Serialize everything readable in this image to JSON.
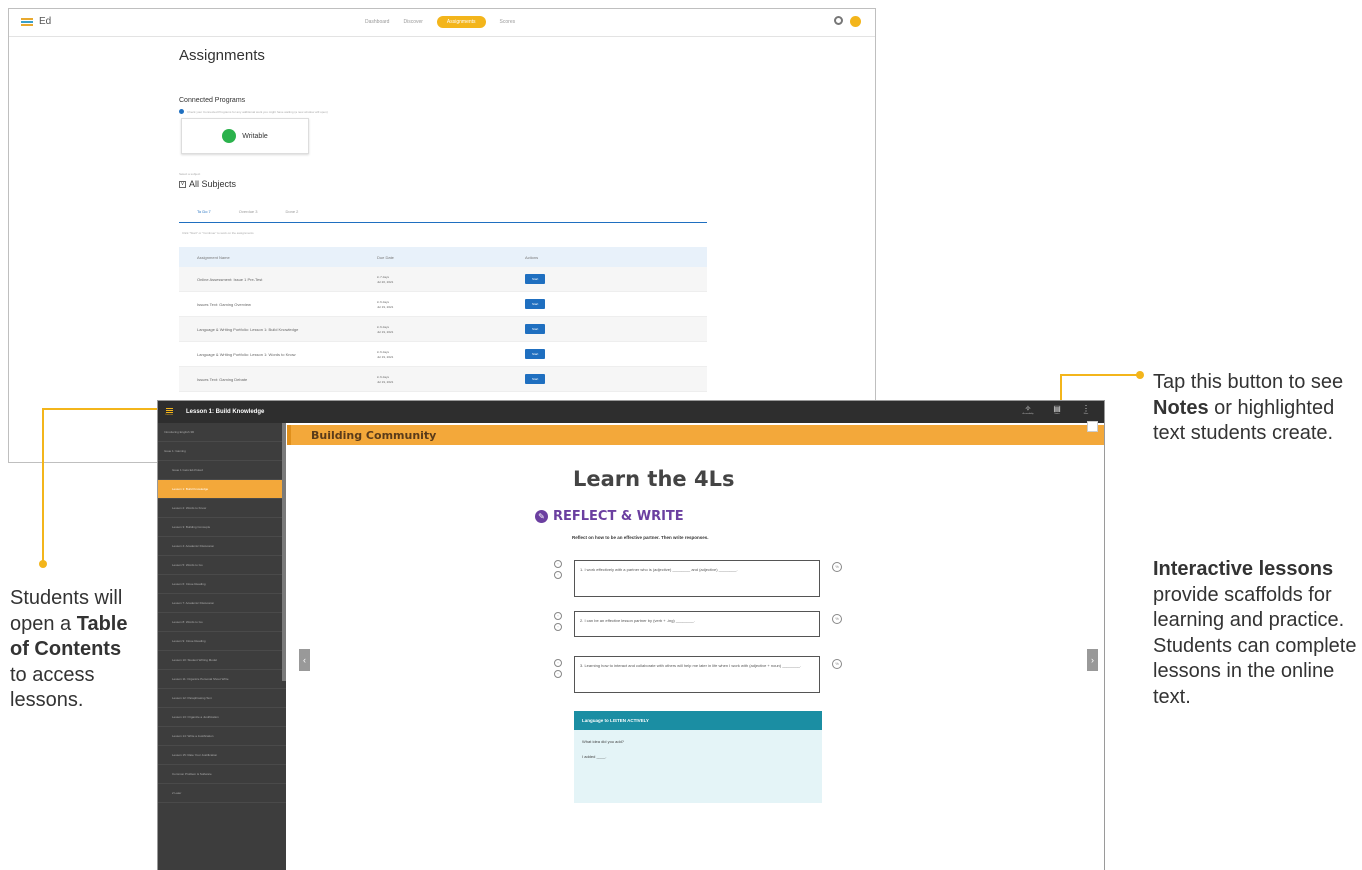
{
  "window1": {
    "app_name": "Ed",
    "nav": [
      "Dashboard",
      "Discover",
      "Assignments",
      "Scores"
    ],
    "active_nav": "Assignments",
    "title": "Assignments",
    "connected_programs_title": "Connected Programs",
    "connected_programs_note": "Check your Connected Programs for any additional work you might have waiting (a new window will open)",
    "program_name": "Writable",
    "subject_label": "Select a subject",
    "subject_value": "All Subjects",
    "tabs": [
      "To Do 7",
      "Overdue 3",
      "Done 2"
    ],
    "tab_hint": "Click \"Start\" or \"Continue\" to work on the assignments",
    "table_headers": [
      "Assignment Name",
      "Due Date",
      "Actions"
    ],
    "rows": [
      {
        "name": "Online Assessment: Issue 1 Pre-Test",
        "due1": "in 7 days",
        "due2": "Jul 20, 2021",
        "action": "Start"
      },
      {
        "name": "Issues Text: Gaming Overview",
        "due1": "in 6 days",
        "due2": "Jul 19, 2021",
        "action": "Start"
      },
      {
        "name": "Language & Writing Portfolio: Lesson 1: Build Knowledge",
        "due1": "in 6 days",
        "due2": "Jul 19, 2021",
        "action": "Start"
      },
      {
        "name": "Language & Writing Portfolio: Lesson 1: Words to Know",
        "due1": "in 6 days",
        "due2": "Jul 19, 2021",
        "action": "Start"
      },
      {
        "name": "Issues Text: Gaming Debate",
        "due1": "in 6 days",
        "due2": "Jul 19, 2021",
        "action": "Start"
      }
    ]
  },
  "window2": {
    "menu_label": "Contents",
    "lesson_title": "Lesson 1: Build Knowledge",
    "bar_icons": [
      {
        "label": "Accessibility",
        "icon": "accessibility-icon"
      },
      {
        "label": "Notes",
        "icon": "notes-icon"
      },
      {
        "label": "More",
        "icon": "more-icon"
      }
    ],
    "toc": [
      {
        "label": "Introducing English 3D",
        "level": 1,
        "active": false
      },
      {
        "label": "Issue 1: Gaming",
        "level": 1,
        "active": false
      },
      {
        "label": "Issue 1 Gets Ed-Poked",
        "level": 2,
        "active": false
      },
      {
        "label": "Lesson 1: Build Knowledge",
        "level": 2,
        "active": true
      },
      {
        "label": "Lesson 2: Words to Know",
        "level": 2,
        "active": false
      },
      {
        "label": "Lesson 3: Building Concepts",
        "level": 2,
        "active": false
      },
      {
        "label": "Lesson 4: Academic Discussion",
        "level": 2,
        "active": false
      },
      {
        "label": "Lesson 5: Words to Go",
        "level": 2,
        "active": false
      },
      {
        "label": "Lesson 6: Close Reading",
        "level": 2,
        "active": false
      },
      {
        "label": "Lesson 7: Academic Discussion",
        "level": 2,
        "active": false
      },
      {
        "label": "Lesson 8: Words to Go",
        "level": 2,
        "active": false
      },
      {
        "label": "Lesson 9: Close Reading",
        "level": 2,
        "active": false
      },
      {
        "label": "Lesson 10: Student Writing Model",
        "level": 2,
        "active": false
      },
      {
        "label": "Lesson 11: Organize Personal Shout Write",
        "level": 2,
        "active": false
      },
      {
        "label": "Lesson 12: Paraphrasing Text",
        "level": 2,
        "active": false
      },
      {
        "label": "Lesson 13: Organize a Justification",
        "level": 2,
        "active": false
      },
      {
        "label": "Lesson 14: Write a Justification",
        "level": 2,
        "active": false
      },
      {
        "label": "Lesson 15: Rate Your Justification",
        "level": 2,
        "active": false
      },
      {
        "label": "Common Problem & Software",
        "level": 2,
        "active": false
      },
      {
        "label": "2 Later",
        "level": 2,
        "active": false
      }
    ],
    "unit_title": "Building Community",
    "page_title": "Learn the 4Ls",
    "section_title": "REFLECT & WRITE",
    "instructions": "Reflect on how to be an effective partner. Then write responses.",
    "prompts": [
      "1. I work effectively with a partner who is (adjective) ________ and (adjective) ________.",
      "2. I can be an effective lesson partner by (verb + -ing) ________.",
      "3. Learning how to interact and collaborate with others will help me later in life when I work with (adjective + noun) ________."
    ],
    "listen_title": "Language to LISTEN ACTIVELY",
    "listen_question": "What idea did you add?",
    "listen_answer": "I added ____."
  },
  "callouts": {
    "notes_pre": "Tap this button to see ",
    "notes_bold": "Notes",
    "notes_post": " or highlighted text students create.",
    "toc_pre": "Students will open a ",
    "toc_bold": "Table of Contents",
    "toc_post": " to access lessons.",
    "interactive_bold": "Interactive lessons",
    "interactive_post": " provide scaffolds for learning and practice. Students can complete lessons in the online text."
  },
  "colors": {
    "accent_yellow": "#f3b51b",
    "lesson_orange": "#f3a83a",
    "reflect_purple": "#6b3fa0",
    "listen_teal": "#1b8ea3",
    "button_blue": "#1f6fc0"
  }
}
